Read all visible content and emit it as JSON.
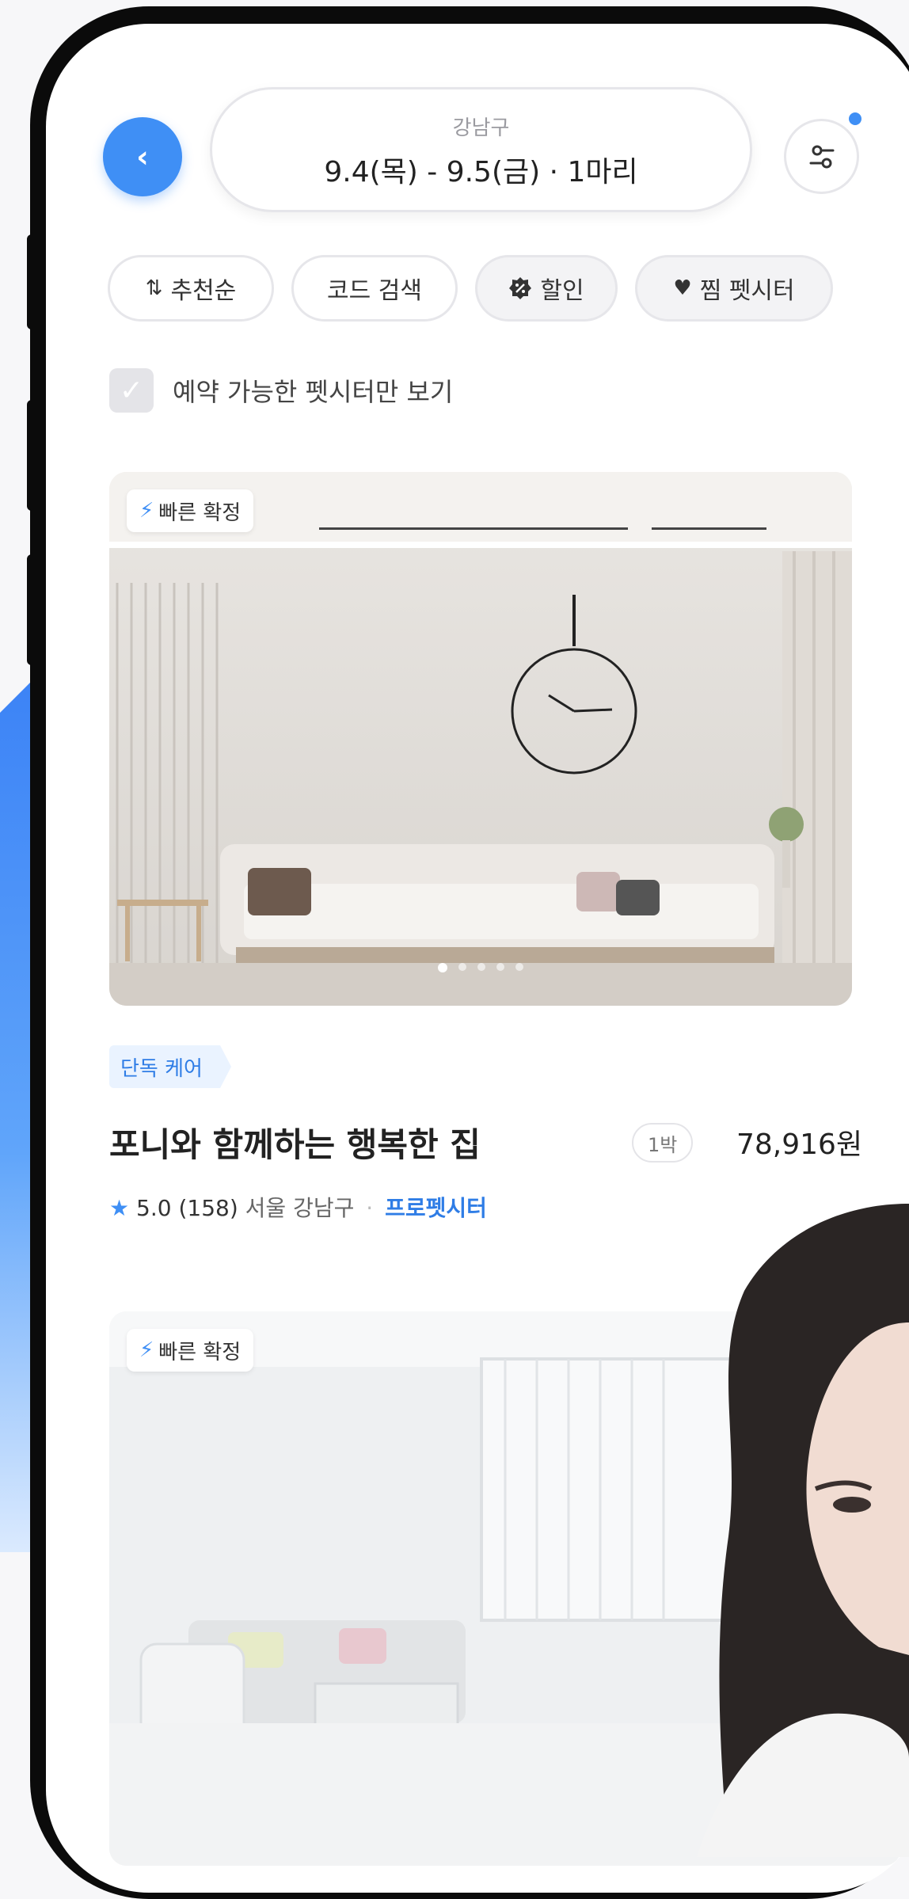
{
  "header": {
    "region": "강남구",
    "dates": "9.4(목) - 9.5(금) · 1마리"
  },
  "chips": [
    {
      "label": "추천순",
      "icon": "sort-arrows-icon"
    },
    {
      "label": "코드 검색",
      "icon": ""
    },
    {
      "label": "할인",
      "icon": "discount-icon"
    },
    {
      "label": "찜 펫시터",
      "icon": "heart-icon"
    }
  ],
  "filter": {
    "checkbox_label": "예약 가능한 펫시터만 보기",
    "checked": false
  },
  "listings": [
    {
      "badge": "빠른 확정",
      "care_tag": "단독 케어",
      "title": "포니와 함께하는 행복한 집",
      "nights": "1박",
      "price": "78,916원",
      "rating": "5.0",
      "reviews": "(158)",
      "location": "서울 강남구",
      "sitter_type": "프로펫시터",
      "photo_index": 1,
      "photo_count": 5
    },
    {
      "badge": "빠른 확정"
    }
  ],
  "colors": {
    "accent": "#3f8ff5",
    "care_tag_bg": "#eaf3ff",
    "care_tag_text": "#2f7de6"
  }
}
